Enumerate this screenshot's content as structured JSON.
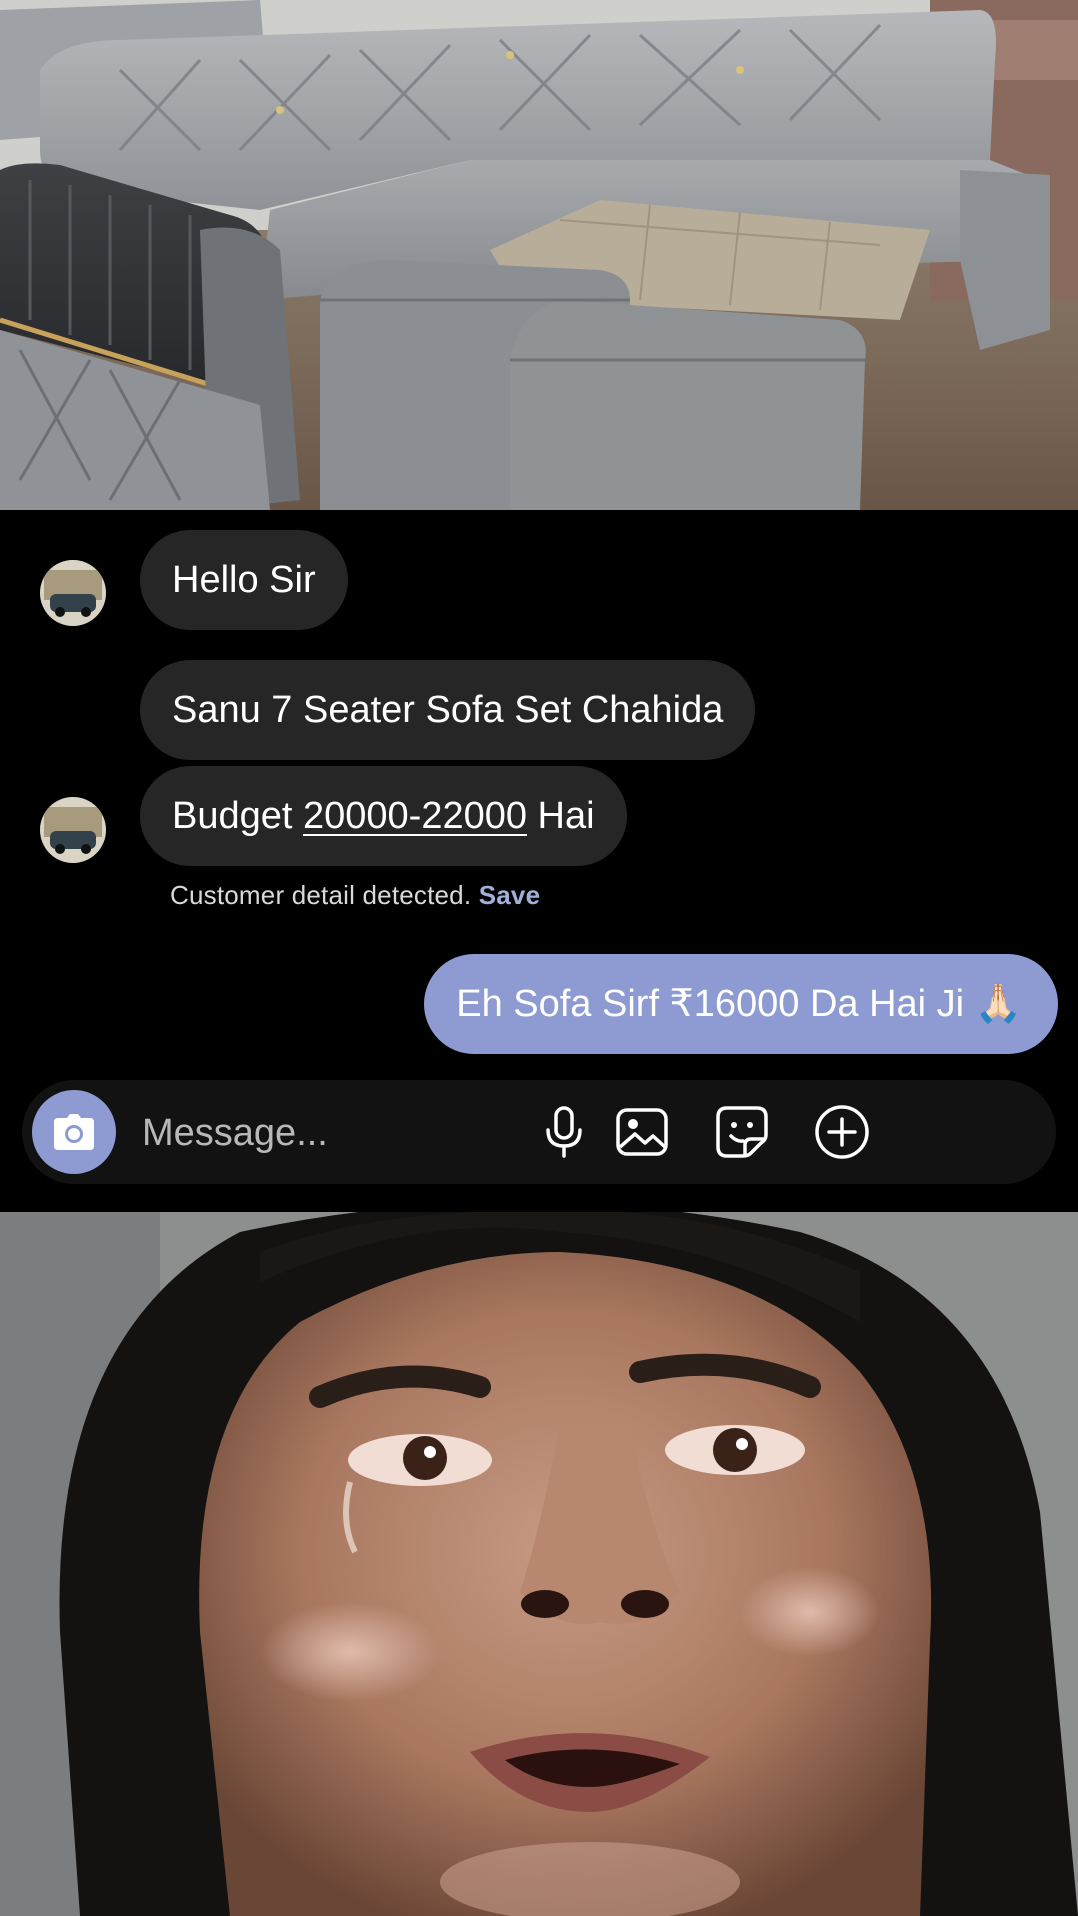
{
  "media": {
    "top_image": "sofa-set-photo",
    "bottom_image": "crying-face-photo"
  },
  "messages": {
    "incoming": [
      {
        "text": "Hello Sir"
      },
      {
        "text": "Sanu 7 Seater Sofa Set Chahida"
      },
      {
        "prefix": "Budget ",
        "detected_value": "20000-22000",
        "suffix": " Hai"
      }
    ],
    "detection_notice": {
      "text": "Customer detail detected.",
      "action": "Save"
    },
    "outgoing": [
      {
        "text": "Eh Sofa Sirf ₹16000 Da Hai Ji 🙏🏻"
      }
    ]
  },
  "composer": {
    "placeholder": "Message...",
    "icons": [
      "camera-icon",
      "microphone-icon",
      "gallery-icon",
      "sticker-icon",
      "plus-icon"
    ]
  },
  "colors": {
    "background": "#000000",
    "incoming_bubble": "#262626",
    "outgoing_bubble": "#8d9bd2",
    "save_link": "#9fb0d9",
    "composer": "#121212"
  }
}
